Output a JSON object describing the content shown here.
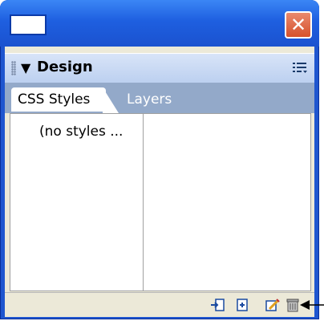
{
  "panel": {
    "title": "Design",
    "tabs": [
      {
        "label": "CSS Styles",
        "active": true
      },
      {
        "label": "Layers",
        "active": false
      }
    ]
  },
  "content": {
    "empty_text": "(no styles ..."
  },
  "footer": {
    "icons": [
      "attach-style-sheet-icon",
      "new-css-rule-icon",
      "edit-style-icon",
      "delete-icon"
    ]
  },
  "colors": {
    "titlebar": "#1e5fe0",
    "close_button": "#d6512b",
    "panel_background": "#ece9d8",
    "tabstrip": "#93a9c9"
  }
}
